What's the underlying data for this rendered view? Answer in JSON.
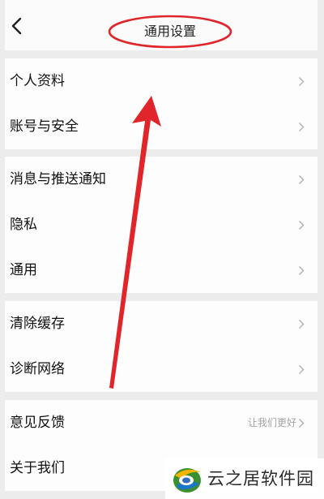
{
  "header": {
    "title": "通用设置"
  },
  "groups": [
    {
      "items": [
        {
          "label": "个人资料"
        },
        {
          "label": "账号与安全"
        }
      ]
    },
    {
      "items": [
        {
          "label": "消息与推送通知"
        },
        {
          "label": "隐私"
        },
        {
          "label": "通用"
        }
      ]
    },
    {
      "items": [
        {
          "label": "清除缓存"
        },
        {
          "label": "诊断网络"
        }
      ]
    },
    {
      "items": [
        {
          "label": "意见反馈",
          "hint": "让我们更好"
        },
        {
          "label": "关于我们"
        }
      ]
    }
  ],
  "annotations": {
    "highlight_color": "#e0262b"
  },
  "watermark": {
    "text": "云之居软件园"
  },
  "icons": {
    "back": "chevron-left-icon",
    "row": "chevron-right-icon"
  }
}
